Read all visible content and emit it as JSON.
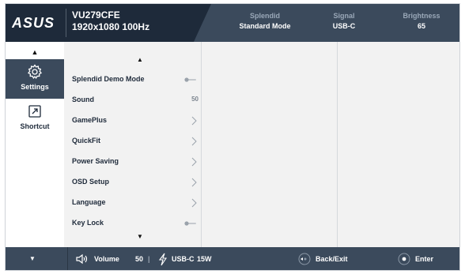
{
  "header": {
    "logo_text": "ASUS",
    "model": "VU279CFE",
    "resolution": "1920x1080 100Hz",
    "status": [
      {
        "label": "Splendid",
        "value": "Standard Mode"
      },
      {
        "label": "Signal",
        "value": "USB-C"
      },
      {
        "label": "Brightness",
        "value": "65"
      }
    ]
  },
  "sidebar": {
    "items": [
      {
        "label": "Settings",
        "icon": "gear-icon",
        "active": true
      },
      {
        "label": "Shortcut",
        "icon": "shortcut-icon",
        "active": false
      }
    ]
  },
  "menu": {
    "items": [
      {
        "label": "Splendid Demo Mode",
        "control": "toggle",
        "value": ""
      },
      {
        "label": "Sound",
        "control": "value",
        "value": "50"
      },
      {
        "label": "GamePlus",
        "control": "chevron",
        "value": ""
      },
      {
        "label": "QuickFit",
        "control": "chevron",
        "value": ""
      },
      {
        "label": "Power Saving",
        "control": "chevron",
        "value": ""
      },
      {
        "label": "OSD Setup",
        "control": "chevron",
        "value": ""
      },
      {
        "label": "Language",
        "control": "chevron",
        "value": ""
      },
      {
        "label": "Key Lock",
        "control": "toggle",
        "value": ""
      }
    ]
  },
  "footer": {
    "volume_label": "Volume",
    "volume_value": "50",
    "power_label": "USB-C",
    "power_value": "15W",
    "back_label": "Back/Exit",
    "enter_label": "Enter"
  },
  "colors": {
    "header_bg": "#1e2a3a",
    "panel_bg": "#3b4a5c",
    "menu_bg": "#f2f2f2",
    "text_dark": "#1e2a3a"
  }
}
